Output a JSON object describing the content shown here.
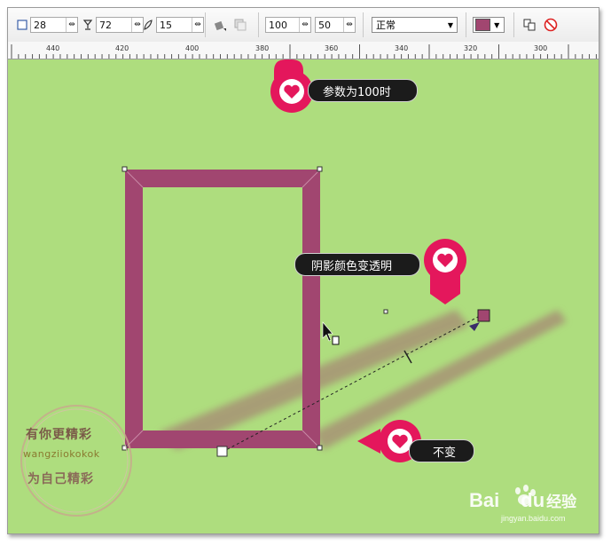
{
  "toolbar": {
    "field1": {
      "value": "28",
      "icon": "square-outline-icon"
    },
    "field2": {
      "value": "72",
      "icon": "goblet-icon"
    },
    "field3": {
      "value": "15",
      "icon": "feather-icon"
    },
    "opacity": {
      "value": "100"
    },
    "feather": {
      "value": "50"
    },
    "blend_mode": {
      "value": "正常"
    },
    "shadow_color": "#a14670"
  },
  "ruler": {
    "labels": [
      "440",
      "420",
      "400",
      "380",
      "360",
      "340",
      "320",
      "300"
    ]
  },
  "annotations": {
    "top": "参数为100时",
    "middle": "阴影颜色变透明",
    "bottom": "不变"
  },
  "watermark": {
    "line1": "有你更精彩",
    "line2": "wangziiokokok",
    "line3": "为自己精彩",
    "baidu": "Bai",
    "baidu_du": "du",
    "baidu_jy": "经验",
    "baidu_url": "jingyan.baidu.com"
  },
  "colors": {
    "canvas": "#aedd7e",
    "rectangle": "#a14670",
    "callout": "#e4175c"
  }
}
